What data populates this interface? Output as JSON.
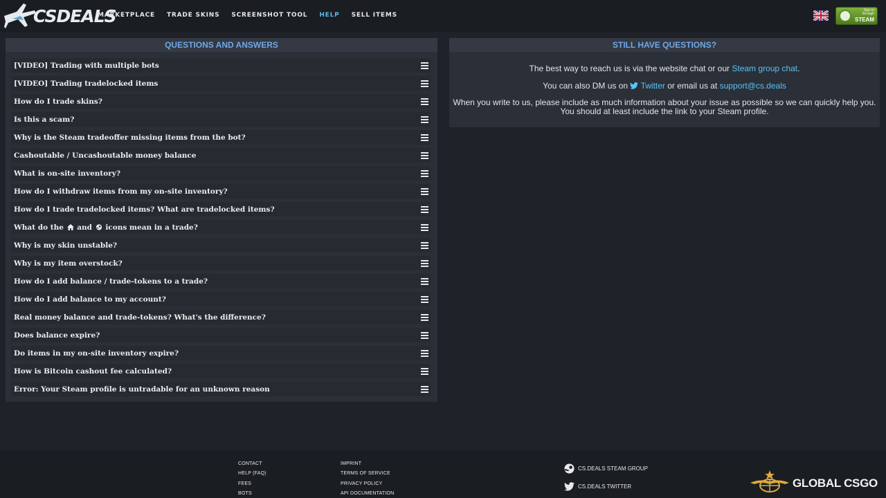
{
  "header": {
    "logo_text": "CSDEALS",
    "nav": [
      {
        "label": "MARKETPLACE",
        "active": false
      },
      {
        "label": "TRADE SKINS",
        "active": false
      },
      {
        "label": "SCREENSHOT TOOL",
        "active": false
      },
      {
        "label": "HELP",
        "active": true
      },
      {
        "label": "SELL ITEMS",
        "active": false
      }
    ],
    "language_icon": "uk-flag-icon",
    "steam_login": {
      "small": "Sign in through",
      "big": "STEAM"
    }
  },
  "faq": {
    "title": "QUESTIONS AND ANSWERS",
    "items": [
      "[VIDEO] Trading with multiple bots",
      "[VIDEO] Trading tradelocked items",
      "How do I trade skins?",
      "Is this a scam?",
      "Why is the Steam tradeoffer missing items from the bot?",
      "Cashoutable / Uncashoutable money balance",
      "What is on-site inventory?",
      "How do I withdraw items from my on-site inventory?",
      "How do I trade tradelocked items? What are tradelocked items?",
      "What do the",
      "Why is my skin unstable?",
      "Why is my item overstock?",
      "How do I add balance / trade-tokens to a trade?",
      "How do I add balance to my account?",
      "Real money balance and trade-tokens? What's the difference?",
      "Does balance expire?",
      "Do items in my on-site inventory expire?",
      "How is Bitcoin cashout fee calculated?",
      "Error: Your Steam profile is untradable for an unknown reason"
    ],
    "icons_item": {
      "prefix": "What do the",
      "and": "and",
      "suffix": "icons mean in a trade?"
    }
  },
  "contact": {
    "title": "STILL HAVE QUESTIONS?",
    "line1": "The best way to reach us is via the website chat or our",
    "line1_link": "Steam group chat",
    "line1_end": ".",
    "line2": "You can also DM us on",
    "line2_link1": "Twitter",
    "line2_mid": "or email us at",
    "line2_link2": "support@cs.deals",
    "line3": "When you write to us, please include as much information about your issue as possible so we can quickly help you.",
    "line4": "You should at least include the link to your Steam profile."
  },
  "footer": {
    "col1": [
      "CONTACT",
      "HELP (FAQ)",
      "FEES",
      "BOTS"
    ],
    "col2": [
      "IMPRINT",
      "TERMS OF SERVICE",
      "PRIVACY POLICY",
      "API DOCUMENTATION"
    ],
    "steam_group": "CS.DEALS STEAM GROUP",
    "twitter": "CS.DEALS TWITTER",
    "partner": "GLOBAL CSGO"
  },
  "colors": {
    "accent": "#5cb6e6",
    "link": "#58c4f5",
    "panel_title": "#6fa8e8",
    "steam_green": "#7fb13b"
  }
}
